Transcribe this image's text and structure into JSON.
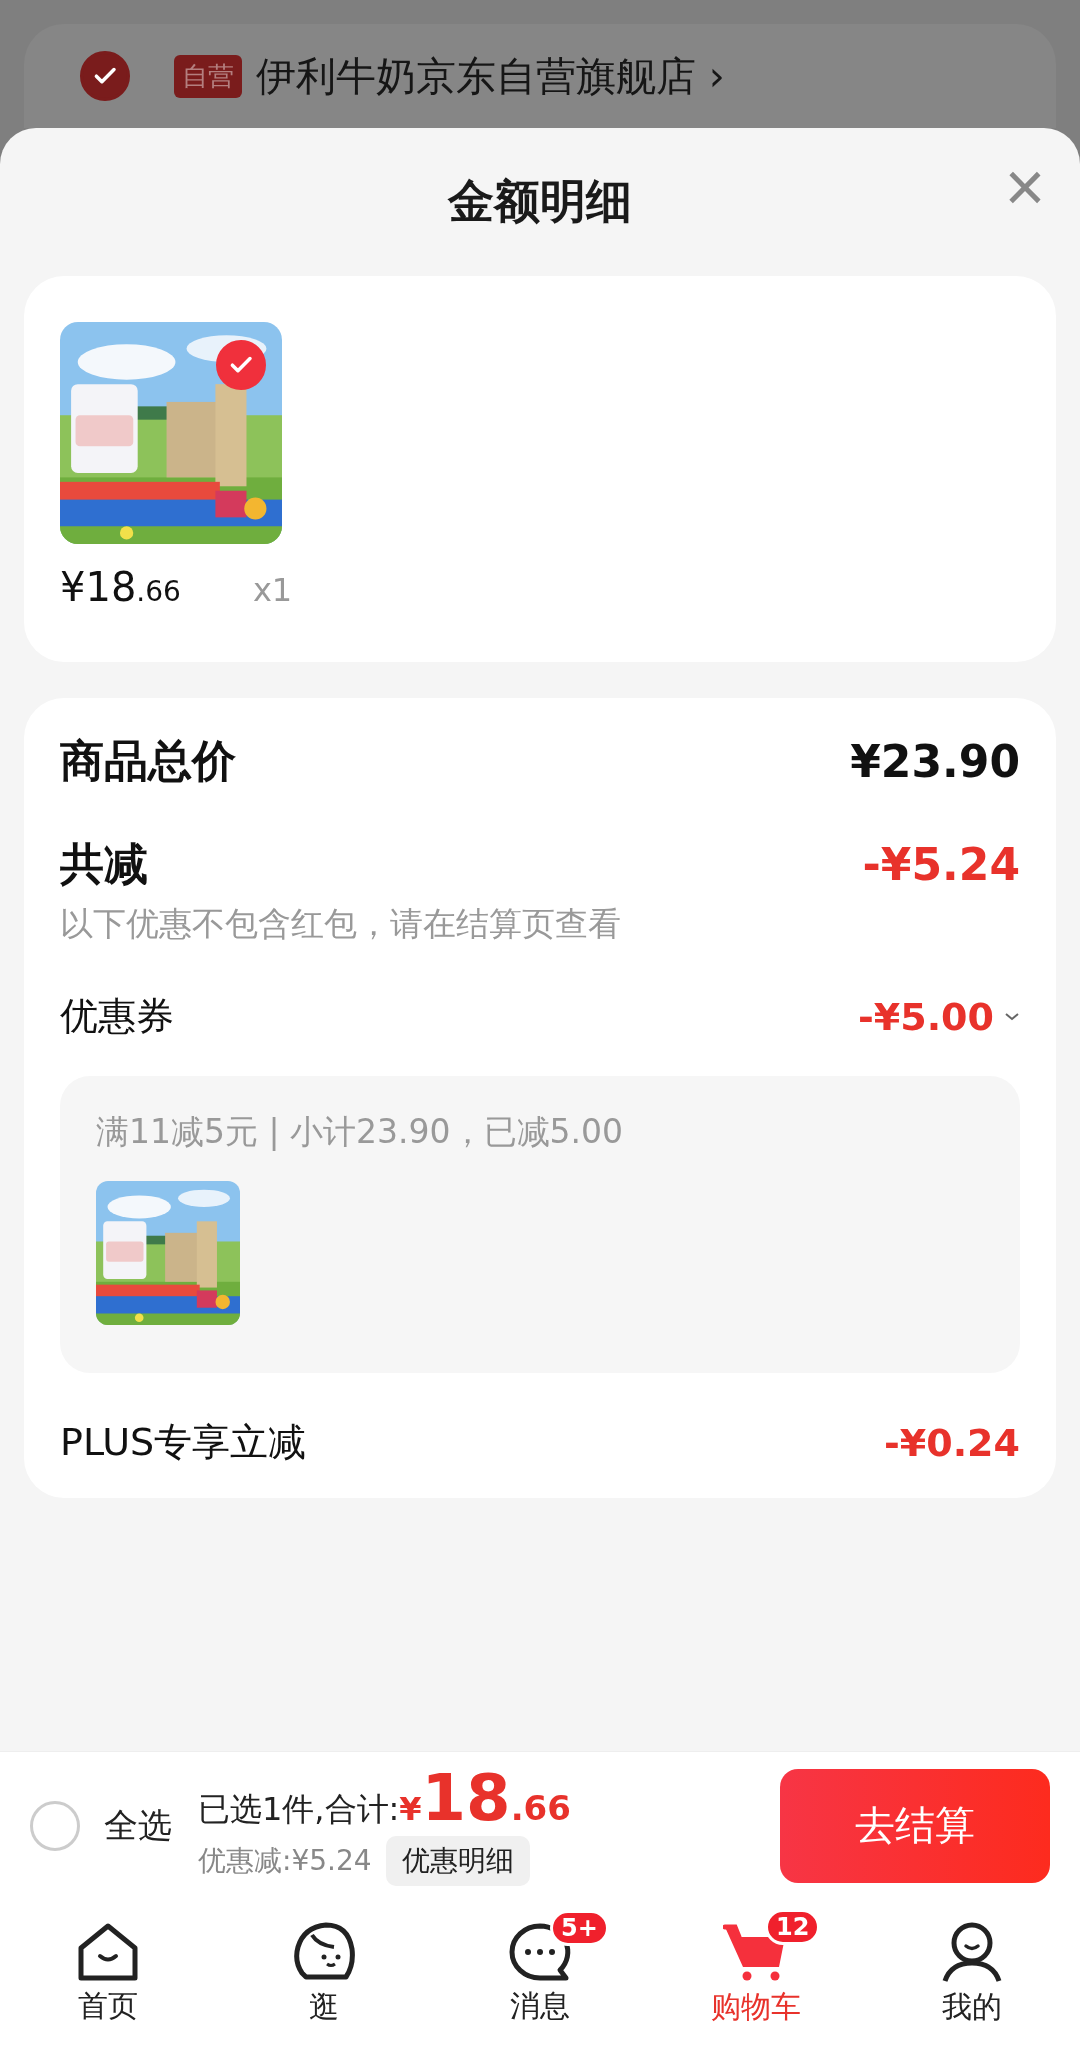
{
  "background": {
    "store_checked": true,
    "store_tag": "自营",
    "store_name": "伊利牛奶京东自营旗舰店 ›"
  },
  "sheet": {
    "title": "金额明细",
    "close": "×"
  },
  "items": [
    {
      "kind": "picture",
      "checked": true,
      "price_main": "¥18",
      "price_decimal": ".66",
      "quantity": "x1"
    }
  ],
  "summary": {
    "total_label": "商品总价",
    "total_value": "¥23.90",
    "reduce_label": "共减",
    "reduce_value": "-¥5.24",
    "reduce_note": "以下优惠不包含红包，请在结算页查看",
    "coupon_label": "优惠券",
    "coupon_value": "-¥5.00",
    "coupon_expanded": true,
    "coupon_detail": "满11减5元 | 小计23.90，已减5.00",
    "plus_label": "PLUS专享立减",
    "plus_value": "-¥0.24"
  },
  "checkout": {
    "select_all_checked": false,
    "select_all_label": "全选",
    "selected_text": "已选1件,合计:",
    "total_currency": "¥",
    "total_main": "18",
    "total_decimal": ".66",
    "discount_text": "优惠减:¥5.24",
    "detail_button": "优惠明细",
    "checkout_button": "去结算"
  },
  "tabs": [
    {
      "kind": "home",
      "label": "首页",
      "selected": false
    },
    {
      "kind": "browse",
      "label": "逛",
      "selected": false
    },
    {
      "kind": "message",
      "label": "消息",
      "selected": false,
      "badge": "5+"
    },
    {
      "kind": "cart",
      "label": "购物车",
      "selected": true,
      "badge": "12"
    },
    {
      "kind": "profile",
      "label": "我的",
      "selected": false
    }
  ]
}
